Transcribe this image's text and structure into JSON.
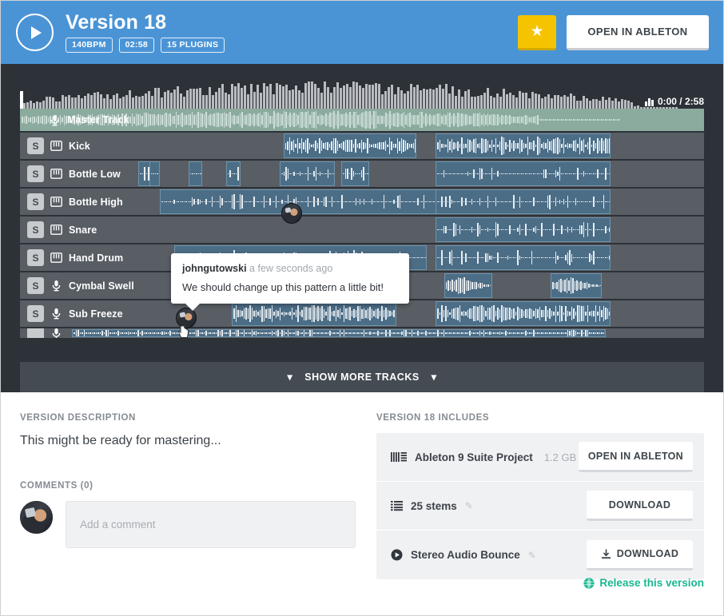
{
  "header": {
    "play_icon": "play-icon",
    "title": "Version 18",
    "pills": [
      {
        "label": "140BPM"
      },
      {
        "label": "02:58"
      },
      {
        "label": "15 PLUGINS"
      }
    ],
    "star_icon": "star-icon",
    "star_glyph": "★",
    "open_button": "OPEN IN ABLETON",
    "accent_color": "#4a94d6",
    "star_color": "#f5c400"
  },
  "daw": {
    "timecode": "0:00 / 2:58",
    "timecode_icon": "levels-icon",
    "master_track": {
      "name": "Master Track",
      "icon": "microphone-icon"
    },
    "solo_label": "S",
    "tracks": [
      {
        "name": "Kick",
        "icon": "midi-icon",
        "solo": "S"
      },
      {
        "name": "Bottle Low",
        "icon": "midi-icon",
        "solo": "S"
      },
      {
        "name": "Bottle High",
        "icon": "midi-icon",
        "solo": "S"
      },
      {
        "name": "Snare",
        "icon": "midi-icon",
        "solo": "S"
      },
      {
        "name": "Hand Drum",
        "icon": "midi-icon",
        "solo": "S"
      },
      {
        "name": "Cymbal Swell",
        "icon": "microphone-icon",
        "solo": "S"
      },
      {
        "name": "Sub Freeze",
        "icon": "microphone-icon",
        "solo": "S"
      }
    ],
    "comment_marker": {
      "avatar": "user-avatar",
      "username": "johngutowski",
      "timestamp": "a few seconds ago",
      "body": "We should change up this pattern a little bit!"
    },
    "show_more": {
      "label": "SHOW MORE TRACKS",
      "left_icon": "chevron-down-icon",
      "right_icon": "chevron-down-icon"
    },
    "background_color": "#2d3238",
    "track_color": "#585e64",
    "master_color": "#8cab9f",
    "clip_color": "#4c6d86"
  },
  "bottom": {
    "description": {
      "label": "VERSION DESCRIPTION",
      "text": "This might be ready for mastering..."
    },
    "comments": {
      "label": "COMMENTS (0)",
      "avatar": "user-avatar",
      "placeholder": "Add a comment"
    },
    "includes": {
      "label": "VERSION 18 INCLUDES",
      "items": [
        {
          "icon": "project-file-icon",
          "name": "Ableton 9 Suite Project",
          "size": "1.2 GB",
          "editable": false,
          "button": "OPEN IN ABLETON",
          "button_icon": ""
        },
        {
          "icon": "stems-list-icon",
          "name": "25 stems",
          "size": "",
          "editable": true,
          "button": "DOWNLOAD",
          "button_icon": ""
        },
        {
          "icon": "play-circle-icon",
          "name": "Stereo Audio Bounce",
          "size": "",
          "editable": true,
          "button": "DOWNLOAD",
          "button_icon": "download-icon"
        }
      ]
    },
    "release": {
      "icon": "globe-icon",
      "label": "Release this version",
      "color": "#17b890"
    }
  }
}
